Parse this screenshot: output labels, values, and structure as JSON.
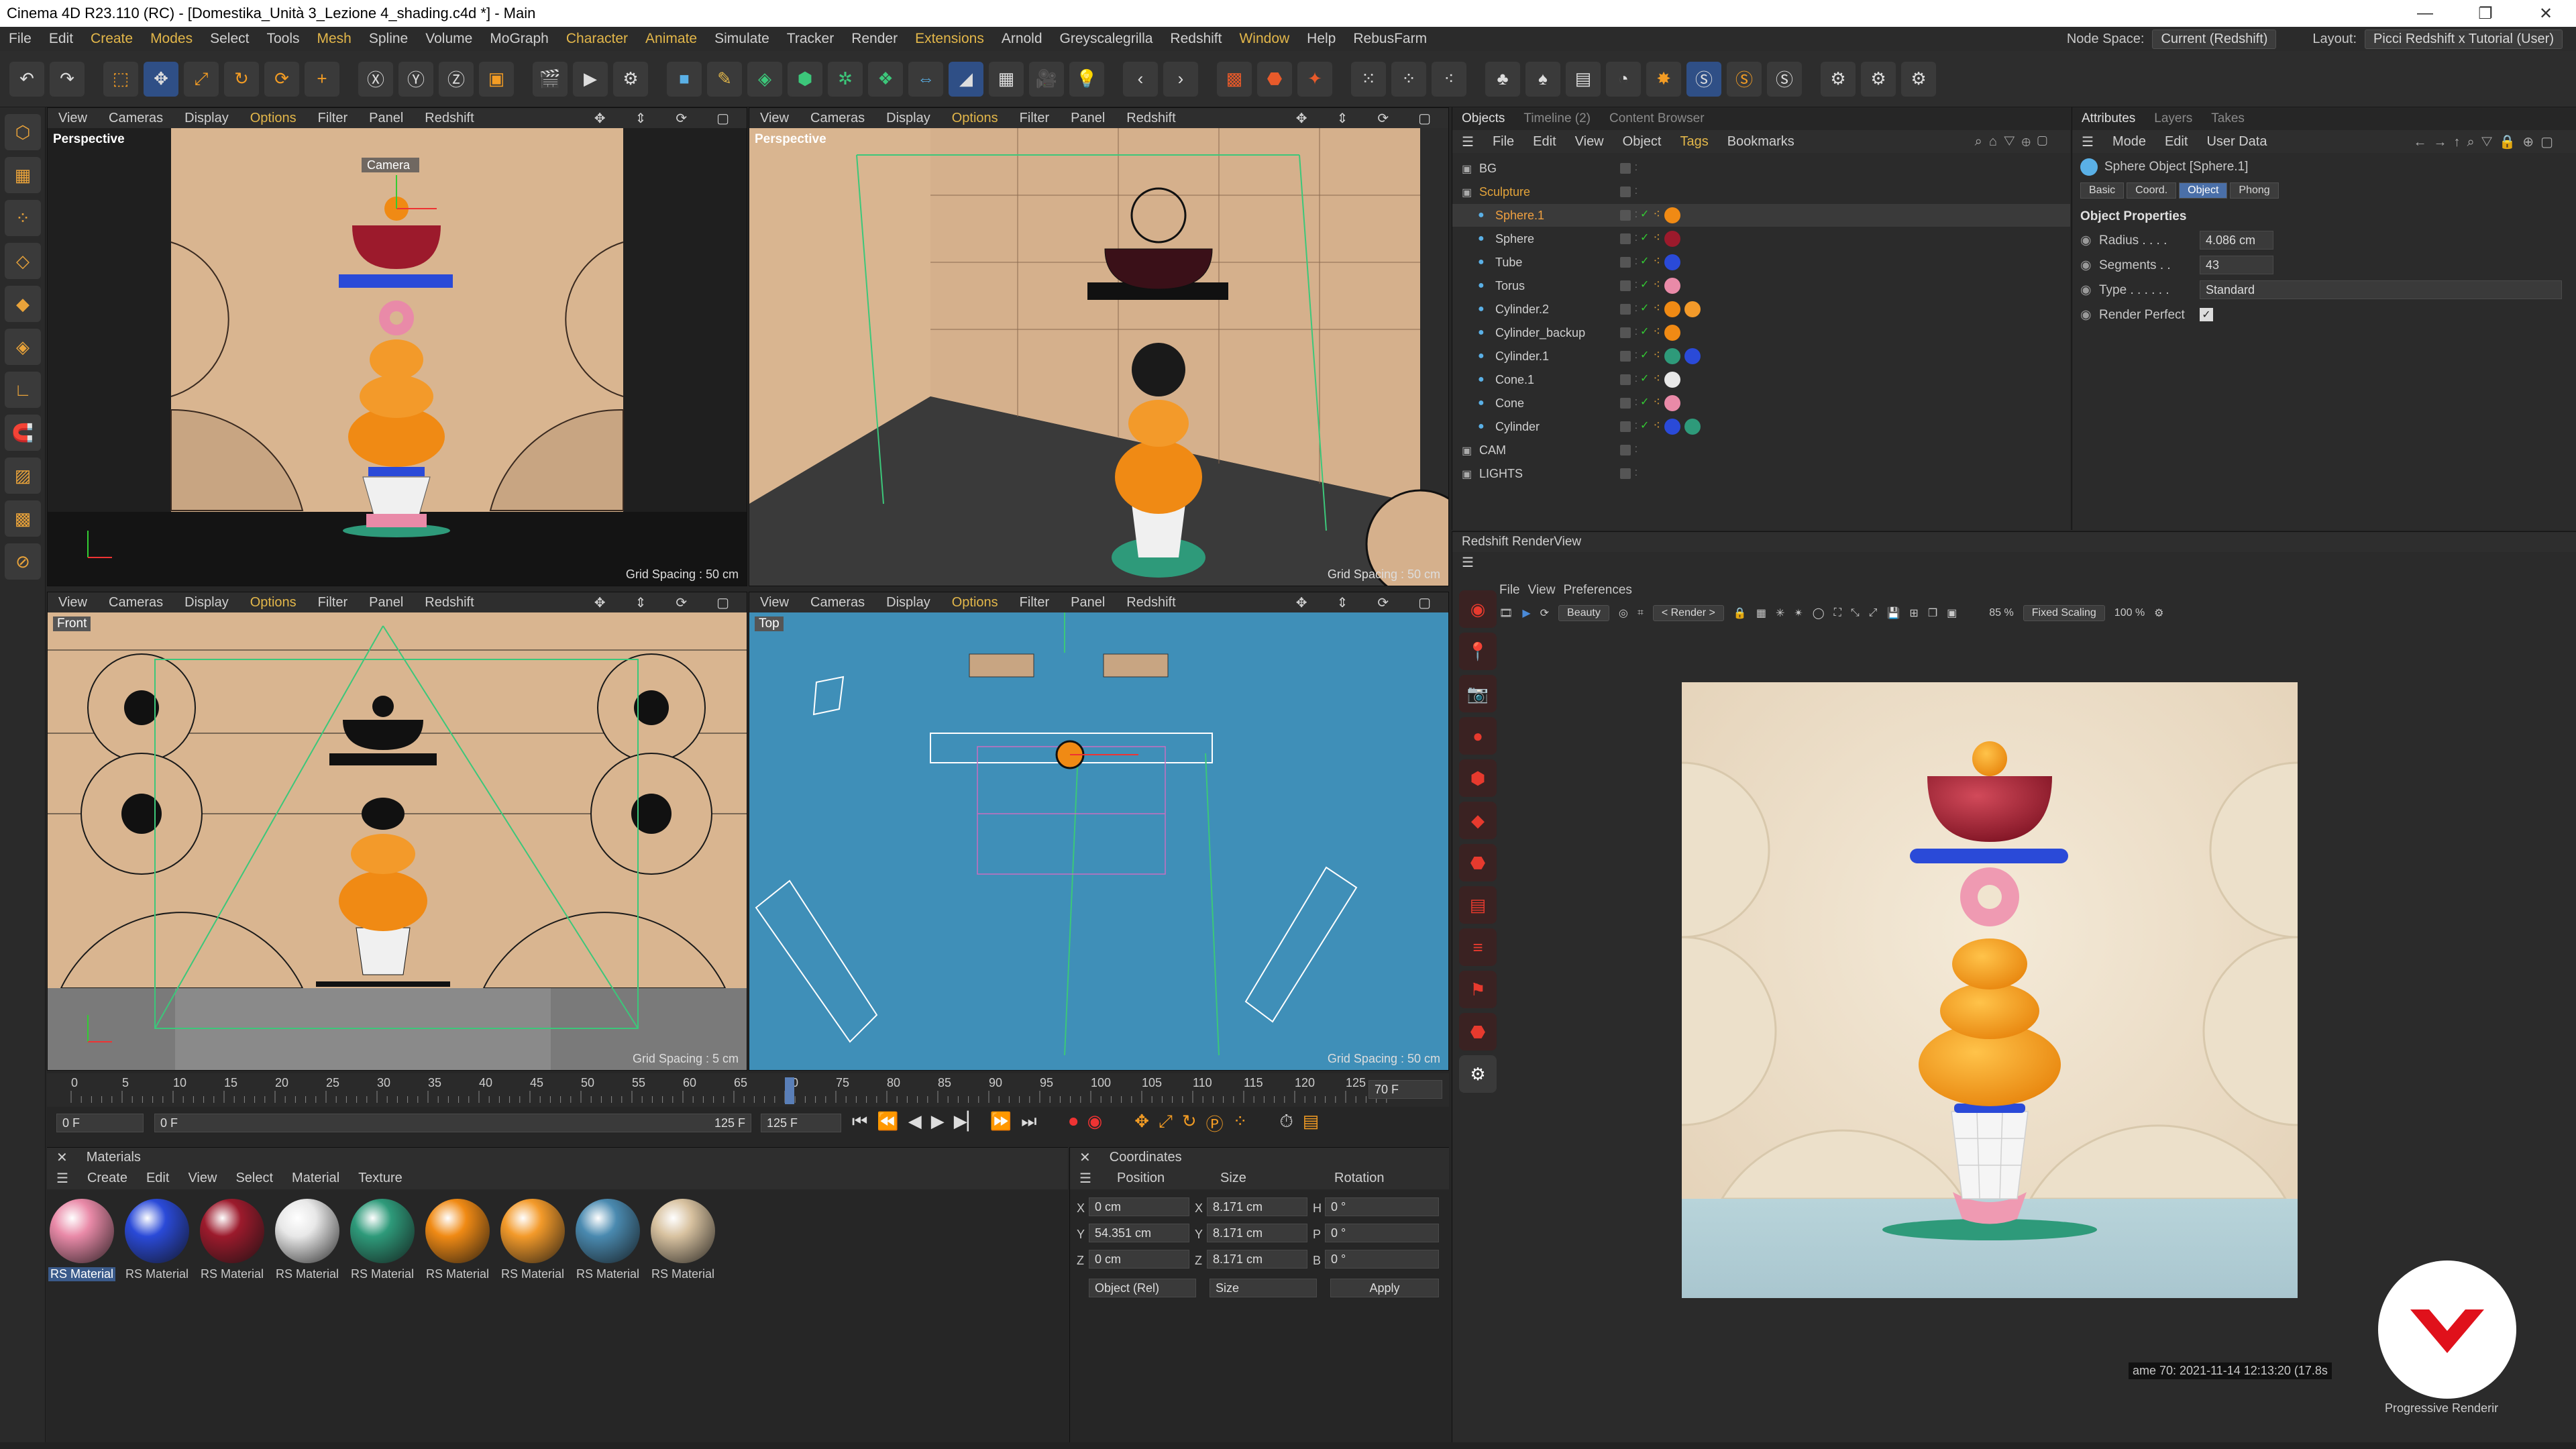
{
  "window": {
    "title": "Cinema 4D R23.110 (RC) - [Domestika_Unità 3_Lezione 4_shading.c4d *] - Main"
  },
  "menu": [
    "File",
    "Edit",
    "Create",
    "Modes",
    "Select",
    "Tools",
    "Mesh",
    "Spline",
    "Volume",
    "MoGraph",
    "Character",
    "Animate",
    "Simulate",
    "Tracker",
    "Render",
    "Extensions",
    "Arnold",
    "Greyscalegrilla",
    "Redshift",
    "Window",
    "Help",
    "RebusFarm"
  ],
  "topright": {
    "node_space_label": "Node Space:",
    "node_space_value": "Current (Redshift)",
    "layout_label": "Layout:",
    "layout_value": "Picci Redshift x Tutorial (User)"
  },
  "viewport_menu": [
    "View",
    "Cameras",
    "Display",
    "Options",
    "Filter",
    "Panel",
    "Redshift"
  ],
  "viewports": {
    "tl": {
      "label": "Perspective",
      "grid": "Grid Spacing : 50 cm",
      "camera_tag": "Camera"
    },
    "tr": {
      "label": "Perspective",
      "grid": "Grid Spacing : 50 cm"
    },
    "bl": {
      "label": "Front",
      "grid": "Grid Spacing : 5 cm"
    },
    "br": {
      "label": "Top",
      "grid": "Grid Spacing : 50 cm"
    }
  },
  "objects_panel": {
    "tabs": [
      "Objects",
      "Timeline (2)",
      "Content Browser"
    ],
    "menu": [
      "File",
      "Edit",
      "View",
      "Object",
      "Tags",
      "Bookmarks"
    ],
    "rows": [
      {
        "name": "BG",
        "indent": 0
      },
      {
        "name": "Sculpture",
        "indent": 0
      },
      {
        "name": "Sphere.1",
        "indent": 1
      },
      {
        "name": "Sphere",
        "indent": 1
      },
      {
        "name": "Tube",
        "indent": 1
      },
      {
        "name": "Torus",
        "indent": 1
      },
      {
        "name": "Cylinder.2",
        "indent": 1
      },
      {
        "name": "Cylinder_backup",
        "indent": 1
      },
      {
        "name": "Cylinder.1",
        "indent": 1
      },
      {
        "name": "Cone.1",
        "indent": 1
      },
      {
        "name": "Cone",
        "indent": 1
      },
      {
        "name": "Cylinder",
        "indent": 1
      },
      {
        "name": "CAM",
        "indent": 0
      },
      {
        "name": "LIGHTS",
        "indent": 0
      }
    ]
  },
  "attributes": {
    "tabs": [
      "Attributes",
      "Layers",
      "Takes"
    ],
    "menu": [
      "Mode",
      "Edit",
      "User Data"
    ],
    "object_title": "Sphere Object [Sphere.1]",
    "subtabs": [
      "Basic",
      "Coord.",
      "Object",
      "Phong"
    ],
    "section": "Object Properties",
    "radius_label": "Radius . . . .",
    "radius": "4.086 cm",
    "segments_label": "Segments . .",
    "segments": "43",
    "type_label": "Type . . . . . .",
    "type": "Standard",
    "render_perfect_label": "Render Perfect"
  },
  "renderview": {
    "title": "Redshift RenderView",
    "menu": [
      "File",
      "View",
      "Preferences"
    ],
    "aov": "Beauty",
    "render_dd": "< Render >",
    "zoom": "85 %",
    "scaling": "Fixed Scaling",
    "scale": "100 %",
    "status": "ame 70: 2021-11-14 12:13:20 (17.8s",
    "progressive": "Progressive Renderir"
  },
  "timeline": {
    "ticks": [
      "0",
      "5",
      "10",
      "15",
      "20",
      "25",
      "30",
      "35",
      "40",
      "45",
      "50",
      "55",
      "60",
      "65",
      "70",
      "75",
      "80",
      "85",
      "90",
      "95",
      "100",
      "105",
      "110",
      "115",
      "120",
      "125"
    ],
    "current": "70 F",
    "start": "0 F",
    "preview_start": "0 F",
    "preview_end": "125 F",
    "end": "125 F"
  },
  "materials": {
    "title": "Materials",
    "menu": [
      "Create",
      "Edit",
      "View",
      "Select",
      "Material",
      "Texture"
    ],
    "items": [
      {
        "label": "RS Material",
        "color": "#e98aa8"
      },
      {
        "label": "RS Material",
        "color": "#2a4ad8"
      },
      {
        "label": "RS Material",
        "color": "#9c1a2c"
      },
      {
        "label": "RS Material",
        "color": "#e8e8e8"
      },
      {
        "label": "RS Material",
        "color": "#2e9a7a"
      },
      {
        "label": "RS Material",
        "color": "#f08a14"
      },
      {
        "label": "RS Material",
        "color": "#f39a2a"
      },
      {
        "label": "RS Material",
        "color": "#4a8ab0"
      },
      {
        "label": "RS Material",
        "color": "#d8c2a0"
      }
    ]
  },
  "coordinates": {
    "title": "Coordinates",
    "headers": [
      "Position",
      "Size",
      "Rotation"
    ],
    "rows": [
      {
        "axis": "X",
        "pos": "0 cm",
        "size_axis": "X",
        "size": "8.171 cm",
        "rot_axis": "H",
        "rot": "0 °"
      },
      {
        "axis": "Y",
        "pos": "54.351 cm",
        "size_axis": "Y",
        "size": "8.171 cm",
        "rot_axis": "P",
        "rot": "0 °"
      },
      {
        "axis": "Z",
        "pos": "0 cm",
        "size_axis": "Z",
        "size": "8.171 cm",
        "rot_axis": "B",
        "rot": "0 °"
      }
    ],
    "mode": "Object (Rel)",
    "size_mode": "Size",
    "apply": "Apply"
  }
}
